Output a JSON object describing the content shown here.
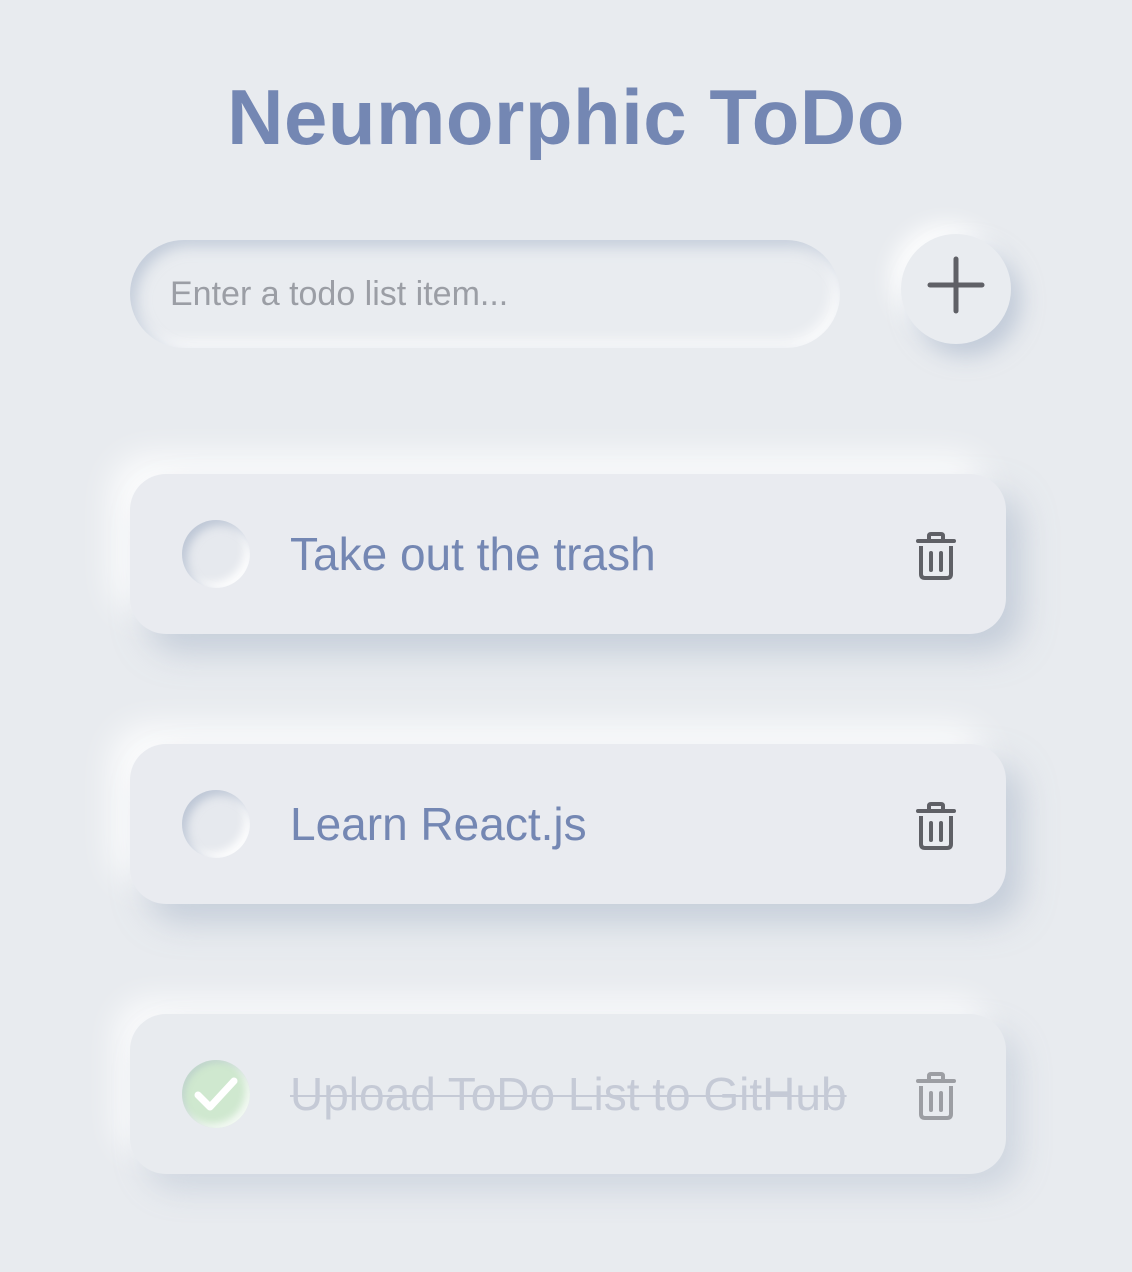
{
  "app": {
    "title": "Neumorphic ToDo"
  },
  "input": {
    "placeholder": "Enter a todo list item...",
    "value": ""
  },
  "add_button": {
    "icon": "plus-icon"
  },
  "todos": [
    {
      "text": "Take out the trash",
      "completed": false
    },
    {
      "text": "Learn React.js",
      "completed": false
    },
    {
      "text": "Upload ToDo List to GitHub",
      "completed": true
    }
  ],
  "colors": {
    "background": "#e8ebef",
    "accent": "#7487b3",
    "completed_text": "#c5cad6",
    "checked_fill": "#cfe8cf",
    "icon": "#5f6066"
  }
}
